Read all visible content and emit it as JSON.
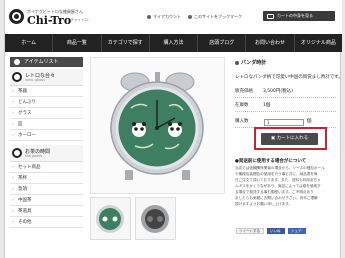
{
  "header": {
    "tagline": "ポイナグビートロな雑貨屋さん",
    "brand": "Chi-Tro",
    "brand_sub": "- チャイトロ -",
    "my_account": "マイアカウント",
    "bookmark": "このサイトをブックマーク",
    "cart_button": "カートの中身を見る"
  },
  "nav": {
    "items": [
      "ホーム",
      "商品一覧",
      "カテゴリで探す",
      "購入方法",
      "店頭ブログ",
      "お問い合わせ",
      "オリジナル商品"
    ]
  },
  "sidebar": {
    "heading": "アイテムリスト",
    "section1": {
      "title": "レトロな台々",
      "subtitle": "retro goods"
    },
    "group1": [
      "茶器",
      "どんぶり",
      "グラス",
      "皿",
      "ホーロー"
    ],
    "section2": {
      "title": "お茶の時間",
      "subtitle": "tea goods"
    },
    "group2": [
      "セット商品",
      "茶杯",
      "急須",
      "中国茶",
      "茶道具",
      "その他"
    ]
  },
  "product": {
    "title": "パンダ時計",
    "description": "レトロなパンダ柄で可愛い中国の目覚まし時計です。",
    "price_label": "販売価格",
    "price_value": "3,500円(税込)",
    "stock_label": "在庫数",
    "stock_value": "1個",
    "qty_label": "購入数",
    "qty_value": "1",
    "qty_unit": "個",
    "add_to_cart": "カートに入れる"
  },
  "notice": {
    "title": "●発送前に使用する場合がについて",
    "lines": [
      "当店では信頼関係業者の場合から、ソースの梱包ボール",
      "や機械包装梱包の使用を行う事と共に、納品書を毎",
      "日ご注文て頂いております。また、送料も利用あちゃ",
      "ルギスをかくうながあり、商品によっては磁を使用す",
      "る場合で発送する事も御座います。ご不明点あり",
      "ましたらお気軽にお問い合わせ下さい。何卒ご理解",
      "頂けますようお願い申し上げます。"
    ]
  },
  "share": {
    "tweet": "ツイートする",
    "like": "いいね",
    "share": "シェア"
  },
  "colors": {
    "nav_bg": "#222222",
    "button_bg": "#4a4a4a",
    "highlight": "#c1272d",
    "clock_face": "#3f7f61",
    "clock_case": "#c8ccd0"
  }
}
